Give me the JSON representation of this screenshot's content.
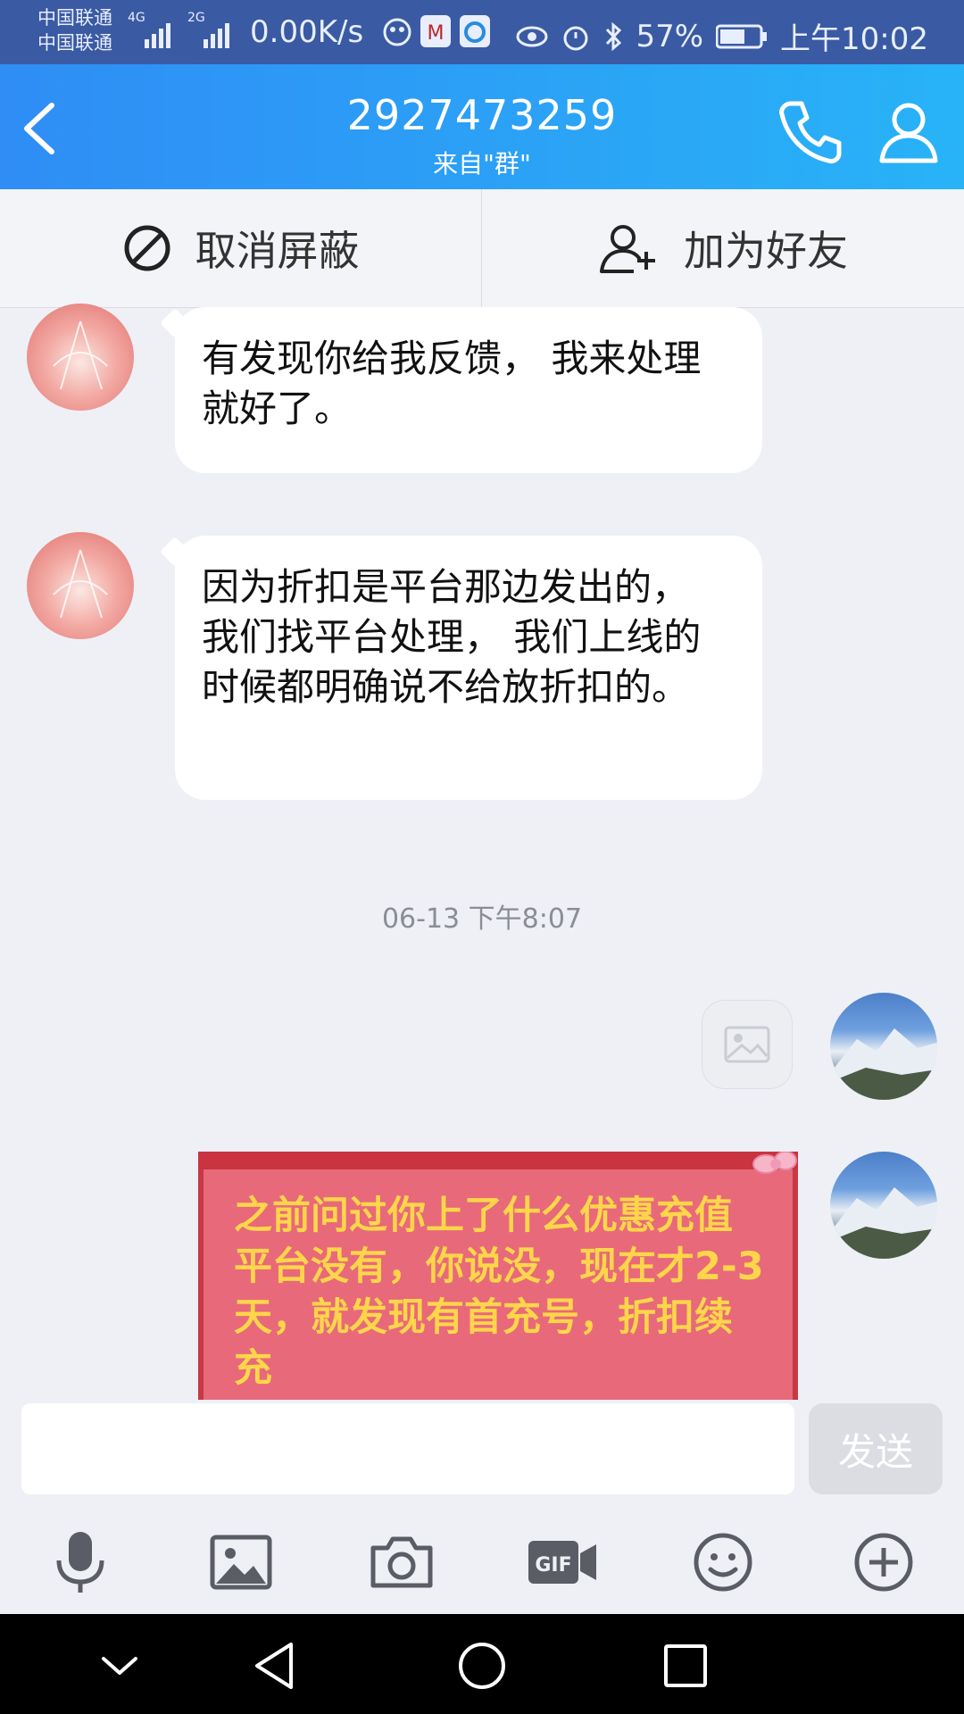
{
  "status_bar": {
    "carrier_1": "中国联通",
    "carrier_2": "中国联通",
    "net_1": "4G",
    "net_2": "2G",
    "speed": "0.00K/s",
    "battery": "57%",
    "time": "上午10:02"
  },
  "header": {
    "title": "2927473259",
    "subtitle": "来自\"群\""
  },
  "actions": {
    "unblock_label": "取消屏蔽",
    "add_friend_label": "加为好友"
  },
  "messages": [
    {
      "side": "left",
      "text": "有发现你给我反馈， 我来处理就好了。"
    },
    {
      "side": "left",
      "text": "因为折扣是平台那边发出的， 我们找平台处理， 我们上线的时候都明确说不给放折扣的。"
    }
  ],
  "timestamp": "06-13 下午8:07",
  "card_message": "之前问过你上了什么优惠充值平台没有，你说没，现在才2-3天，就发现有首充号，折扣续充",
  "input": {
    "value": "",
    "placeholder": ""
  },
  "send_label": "发送",
  "toolbar_icons": [
    "microphone-icon",
    "image-icon",
    "camera-icon",
    "gif-icon",
    "emoji-icon",
    "plus-icon"
  ],
  "nav_icons": [
    "collapse-icon",
    "back-icon",
    "home-icon",
    "recents-icon"
  ],
  "colors": {
    "header_start": "#2f8df5",
    "header_end": "#28b3f7",
    "card_bg": "#e8697a",
    "card_text": "#ffd64a"
  }
}
